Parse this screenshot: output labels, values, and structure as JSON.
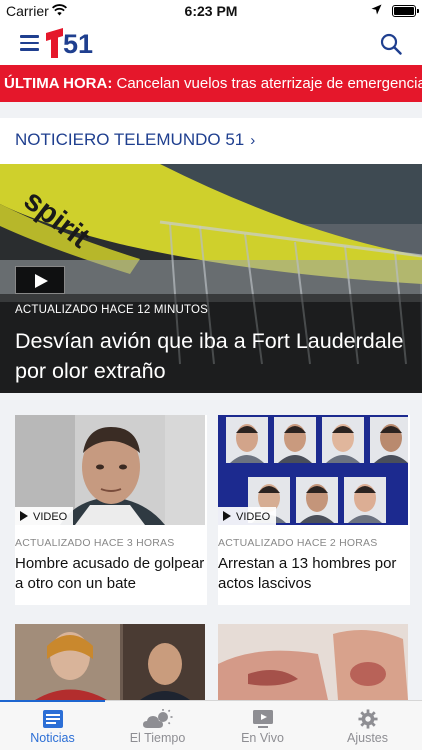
{
  "status_bar": {
    "carrier": "Carrier",
    "time": "6:23 PM"
  },
  "header": {
    "logo_text": "51",
    "menu_icon": "hamburger-icon",
    "search_icon": "search-icon"
  },
  "breaking": {
    "label": "ÚLTIMA HORA:",
    "text": "Cancelan vuelos tras aterrizaje de emergencia"
  },
  "section": {
    "title": "NOTICIERO TELEMUNDO 51",
    "chevron": "›"
  },
  "hero": {
    "meta": "ACTUALIZADO HACE 12 MINUTOS",
    "title": "Desvían avión que iba a Fort Lauderdale por olor extraño",
    "image_text": "spirit"
  },
  "cards": [
    {
      "badge": "VIDEO",
      "meta": "ACTUALIZADO HACE 3 HORAS",
      "title": "Hombre acusado de golpear a otro con un bate"
    },
    {
      "badge": "VIDEO",
      "meta": "ACTUALIZADO HACE 2 HORAS",
      "title": "Arrestan a 13 hombres por actos lascivos"
    }
  ],
  "tabs": [
    {
      "label": "Noticias",
      "icon": "news-icon",
      "active": true
    },
    {
      "label": "El Tiempo",
      "icon": "weather-icon",
      "active": false
    },
    {
      "label": "En Vivo",
      "icon": "live-tv-icon",
      "active": false
    },
    {
      "label": "Ajustes",
      "icon": "gear-icon",
      "active": false
    }
  ],
  "colors": {
    "brand_blue": "#1f3f8f",
    "breaking_red": "#e5172b",
    "tab_active": "#2c6fd6",
    "tab_inactive": "#8e8e93"
  }
}
